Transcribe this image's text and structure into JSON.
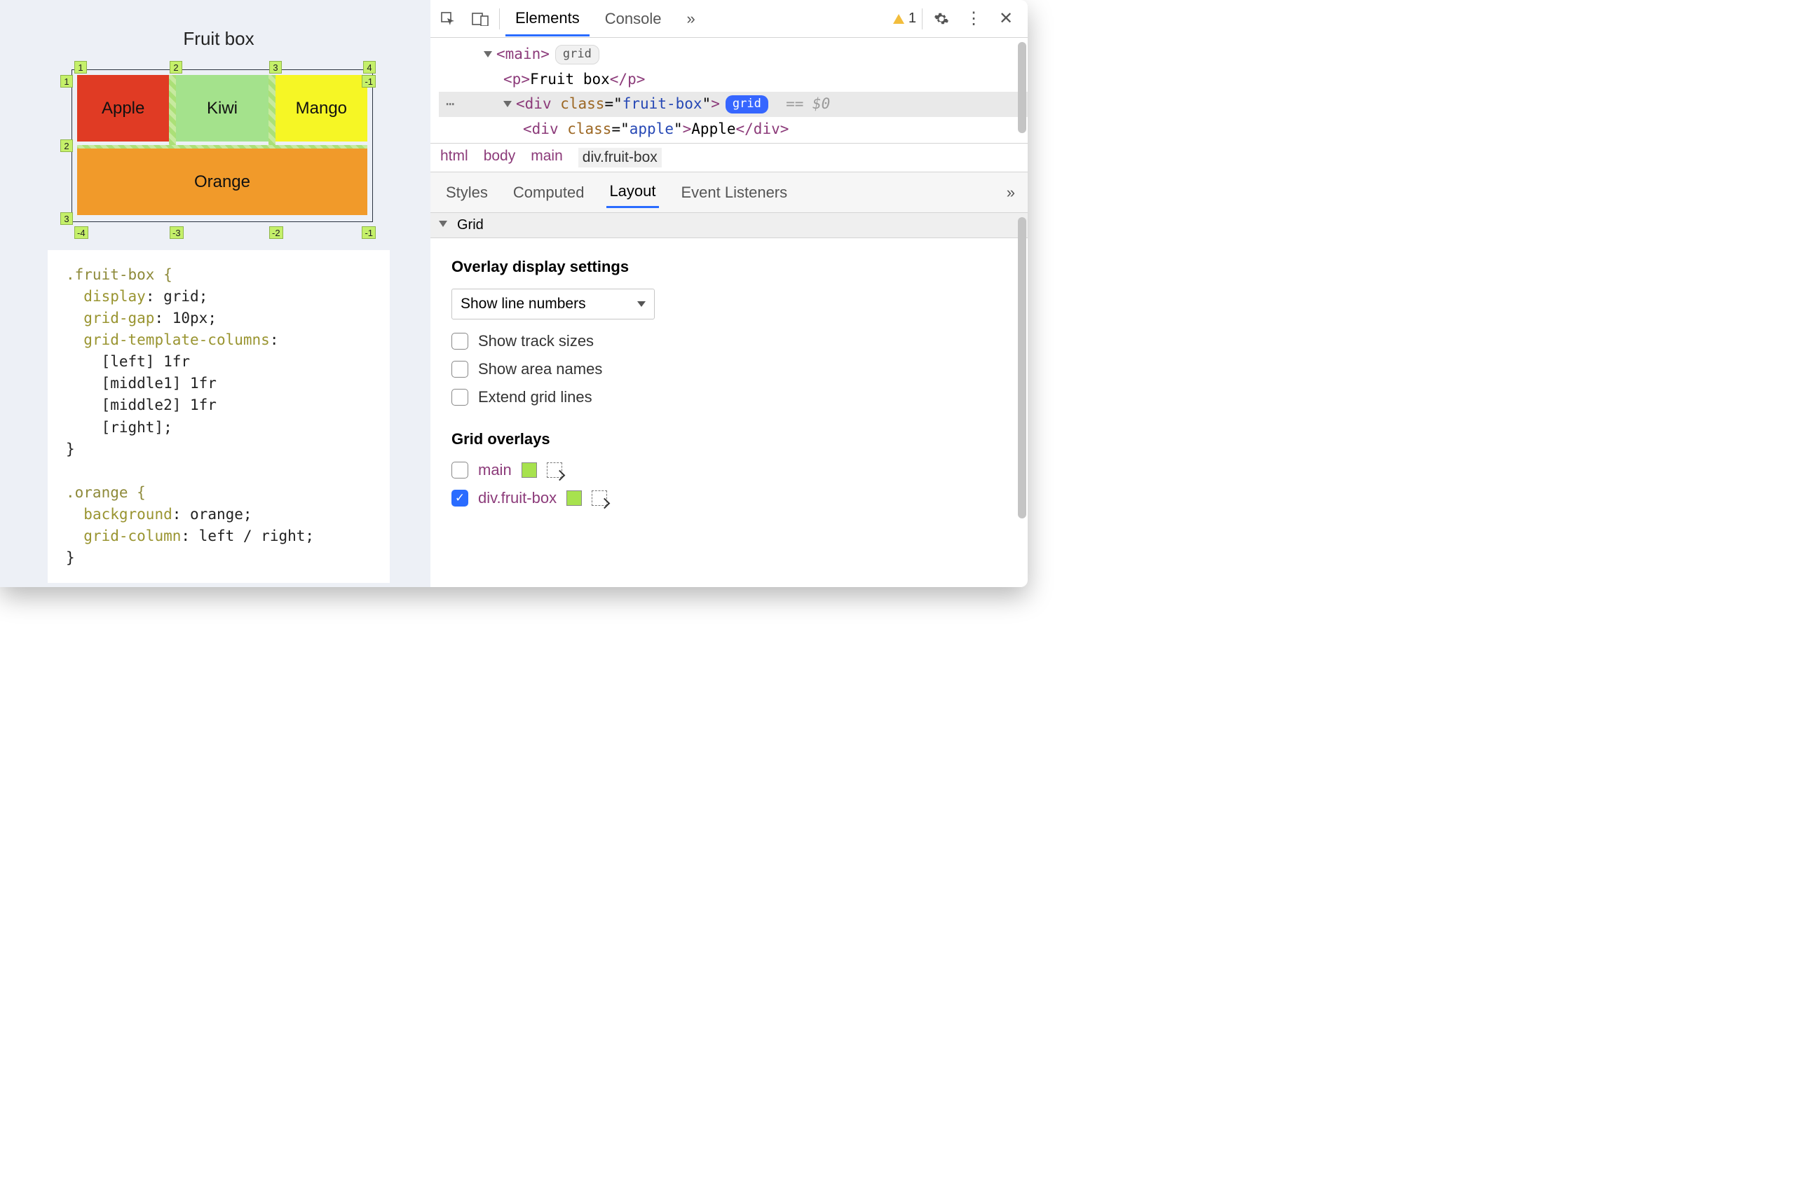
{
  "preview": {
    "title": "Fruit box",
    "cells": {
      "apple": "Apple",
      "kiwi": "Kiwi",
      "mango": "Mango",
      "orange": "Orange"
    },
    "line_numbers": {
      "top": [
        "1",
        "2",
        "3",
        "4"
      ],
      "bottom": [
        "-4",
        "-3",
        "-2",
        "-1"
      ],
      "left": [
        "1",
        "2",
        "3"
      ],
      "right": [
        "-1"
      ]
    },
    "css_lines": [
      ".fruit-box {",
      "  display: grid;",
      "  grid-gap: 10px;",
      "  grid-template-columns:",
      "    [left] 1fr",
      "    [middle1] 1fr",
      "    [middle2] 1fr",
      "    [right];",
      "}",
      "",
      ".orange {",
      "  background: orange;",
      "  grid-column: left / right;",
      "}"
    ]
  },
  "devtools": {
    "tabs": {
      "elements": "Elements",
      "console": "Console",
      "more": "»"
    },
    "warning_count": "1",
    "dom": {
      "main_open": "main",
      "main_badge": "grid",
      "p_text": "Fruit box",
      "div_attr_name": "class",
      "div_attr_val": "fruit-box",
      "div_badge": "grid",
      "eqzero": "== $0",
      "child_attr_val": "apple",
      "child_text": "Apple"
    },
    "breadcrumb": [
      "html",
      "body",
      "main",
      "div.fruit-box"
    ],
    "subtabs": {
      "styles": "Styles",
      "computed": "Computed",
      "layout": "Layout",
      "listeners": "Event Listeners",
      "more": "»"
    },
    "grid_section_label": "Grid",
    "overlay_settings_heading": "Overlay display settings",
    "line_number_select": "Show line numbers",
    "checkboxes": {
      "track_sizes": "Show track sizes",
      "area_names": "Show area names",
      "extend_lines": "Extend grid lines"
    },
    "grid_overlays_heading": "Grid overlays",
    "overlays": [
      {
        "label": "main",
        "checked": false
      },
      {
        "label": "div.fruit-box",
        "checked": true
      }
    ]
  }
}
